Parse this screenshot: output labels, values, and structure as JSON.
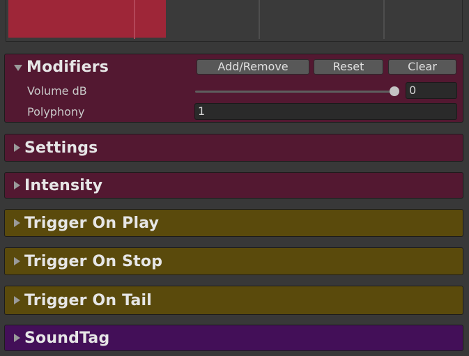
{
  "timeline": {
    "clip_color": "#9e2638"
  },
  "modifiers": {
    "title": "Modifiers",
    "expanded": true,
    "buttons": {
      "add_remove": "Add/Remove",
      "reset": "Reset",
      "clear": "Clear"
    },
    "volume": {
      "label": "Volume dB",
      "value": "0",
      "slider_fraction": 1.0
    },
    "polyphony": {
      "label": "Polyphony",
      "value": "1"
    }
  },
  "sections": [
    {
      "title": "Settings",
      "color": "#531831"
    },
    {
      "title": "Intensity",
      "color": "#531831"
    },
    {
      "title": "Trigger On Play",
      "color": "#5a4a0c"
    },
    {
      "title": "Trigger On Stop",
      "color": "#5a4a0c"
    },
    {
      "title": "Trigger On Tail",
      "color": "#5a4a0c"
    },
    {
      "title": "SoundTag",
      "color": "#430f58"
    }
  ]
}
